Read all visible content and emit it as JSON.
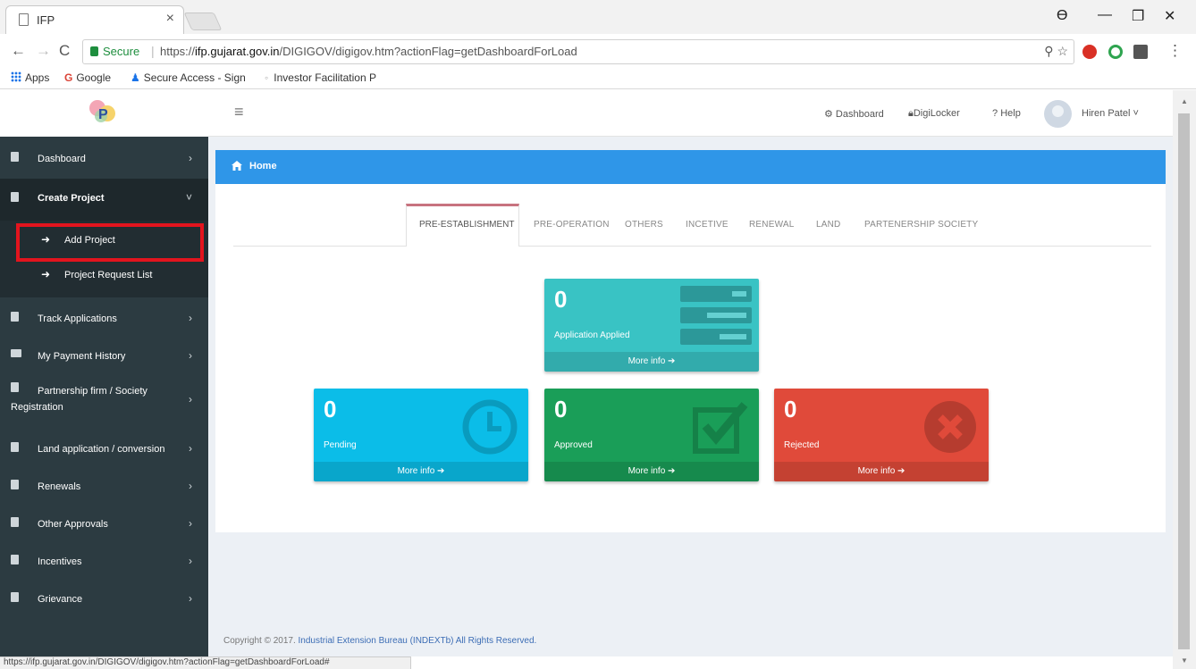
{
  "browser": {
    "tab_title": "IFP",
    "tab_close": "×",
    "secure_label": "Secure",
    "url_prefix": "https://",
    "url_host": "ifp.gujarat.gov.in",
    "url_path": "/DIGIGOV/digigov.htm?actionFlag=getDashboardForLoad",
    "window_controls": {
      "minimize": "—",
      "restore": "❐",
      "close": "✕"
    },
    "nav": {
      "back": "←",
      "forward": "→",
      "reload": "C"
    },
    "omni_icons": "⚲ ☆",
    "menu": "⋮",
    "profile": "ϴ"
  },
  "bookmarks": [
    {
      "label": "Apps"
    },
    {
      "label": "Google"
    },
    {
      "label": "Secure Access - Sign"
    },
    {
      "label": "Investor Facilitation P"
    }
  ],
  "header": {
    "menu_icon": "≡",
    "nav": [
      {
        "label": "Dashboard",
        "icon": "dashboard-icon"
      },
      {
        "label": "DigiLocker",
        "icon": "lock-icon"
      },
      {
        "label": "Help",
        "icon": "help-icon"
      }
    ],
    "user_name": "Hiren Patel",
    "help_prefix": "?",
    "user_caret": "˅"
  },
  "sidebar": {
    "items": [
      {
        "label": "Dashboard",
        "chevron": "›"
      },
      {
        "label": "Create Project",
        "chevron": "˅"
      },
      {
        "label": "Track Applications",
        "chevron": "›"
      },
      {
        "label": "My Payment History",
        "chevron": "›"
      },
      {
        "label": "Partnership firm / Society",
        "label2": "Registration",
        "chevron": "›"
      },
      {
        "label": "Land application / conversion",
        "chevron": "›"
      },
      {
        "label": "Renewals",
        "chevron": "›"
      },
      {
        "label": "Other Approvals",
        "chevron": "›"
      },
      {
        "label": "Incentives",
        "chevron": "›"
      },
      {
        "label": "Grievance",
        "chevron": "›"
      }
    ],
    "sub_items": [
      {
        "label": "Add Project",
        "arrow": "➜"
      },
      {
        "label": "Project Request List",
        "arrow": "➜"
      }
    ]
  },
  "content": {
    "breadcrumb": "Home",
    "tabs": [
      "PRE-ESTABLISHMENT",
      "PRE-OPERATION",
      "OTHERS",
      "INCETIVE",
      "RENEWAL",
      "LAND",
      "PARTENERSHIP SOCIETY"
    ],
    "active_tab": "PRE-ESTABLISHMENT",
    "boxes": [
      {
        "count": "0",
        "caption": "Application Applied",
        "more": "More info ➔",
        "color": "#39c3c4"
      },
      {
        "count": "0",
        "caption": "Pending",
        "more": "More info ➔",
        "color": "#0bbde8"
      },
      {
        "count": "0",
        "caption": "Approved",
        "more": "More info ➔",
        "color": "#1a9e58"
      },
      {
        "count": "0",
        "caption": "Rejected",
        "more": "More info ➔",
        "color": "#e04a3a"
      }
    ]
  },
  "footer": {
    "copyright_prefix": "Copyright © 2017.",
    "org": "Industrial Extension Bureau (INDEXTb)",
    "rights": "All Rights Reserved."
  },
  "status_bar": "https://ifp.gujarat.gov.in/DIGIGOV/digigov.htm?actionFlag=getDashboardForLoad#",
  "colors": {
    "sidebar": "#2c3b41",
    "header_bar": "#2f96e8",
    "highlight": "#e3141e"
  }
}
